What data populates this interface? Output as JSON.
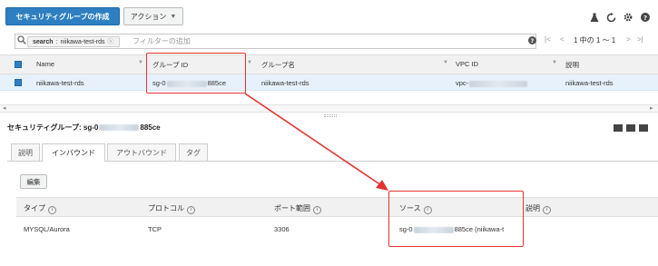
{
  "toolbar": {
    "create_button": "セキュリティグループの作成",
    "actions_button": "アクション",
    "icons": [
      "flask-icon",
      "refresh-icon",
      "gear-icon",
      "help-icon"
    ]
  },
  "filter": {
    "chip_key": "search",
    "chip_value": "niikawa-test-rds",
    "placeholder": "フィルターの追加",
    "pager_text": "1 中の 1 ～ 1"
  },
  "table": {
    "headers": [
      "Name",
      "グループ ID",
      "グループ名",
      "VPC ID",
      "説明"
    ],
    "row": {
      "name": "niikawa-test-rds",
      "group_id_prefix": "sg-0",
      "group_id_suffix": "885ce",
      "group_name": "niikawa-test-rds",
      "vpc_prefix": "vpc-",
      "description": "niikawa-test-rds"
    }
  },
  "detail": {
    "title_prefix": "セキュリティグループ: sg-0",
    "title_suffix": "885ce",
    "tabs": [
      "説明",
      "インバウンド",
      "アウトバウンド",
      "タグ"
    ],
    "active_tab": "インバウンド",
    "edit_button": "編集",
    "rule_headers": [
      "タイプ",
      "プロトコル",
      "ポート範囲",
      "ソース",
      "説明"
    ],
    "rule": {
      "type": "MYSQL/Aurora",
      "protocol": "TCP",
      "port": "3306",
      "source_prefix": "sg-0",
      "source_suffix": "885ce (niikawa-t"
    }
  },
  "colors": {
    "primary": "#2d7fc1",
    "highlight": "#e23333",
    "selected_row": "#e6f1fb"
  }
}
